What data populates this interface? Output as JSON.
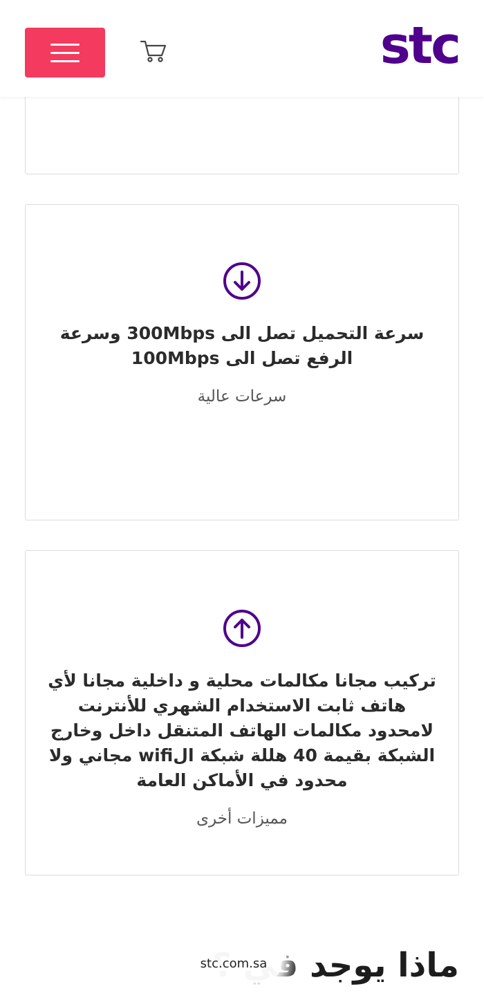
{
  "header": {
    "menu_icon": "hamburger-menu-icon",
    "cart_icon": "shopping-cart-icon",
    "logo_text": "stc",
    "menu_color": "#f43a5e",
    "brand_color": "#4f008c"
  },
  "cards": [
    {
      "icon": "arrow-down-circle-icon",
      "text": "سرعة التحميل تصل الى 300Mbps وسرعة الرفع تصل الى 100Mbps",
      "subtitle": "سرعات عالية"
    },
    {
      "icon": "arrow-up-circle-icon",
      "text": "تركيب مجانا مكالمات محلية و داخلية مجانا لأي هاتف ثابت الاستخدام الشهري للأنترنت لامحدود مكالمات الهاتف المتنقل داخل وخارج الشبكة بقيمة 40 هللة شبكة الwifi مجاني ولا محدود في الأماكن العامة",
      "subtitle": "مميزات أخرى"
    }
  ],
  "section": {
    "title": "ماذا يوجد في ؟"
  },
  "watermark": {
    "domain": "stc.com.sa"
  }
}
